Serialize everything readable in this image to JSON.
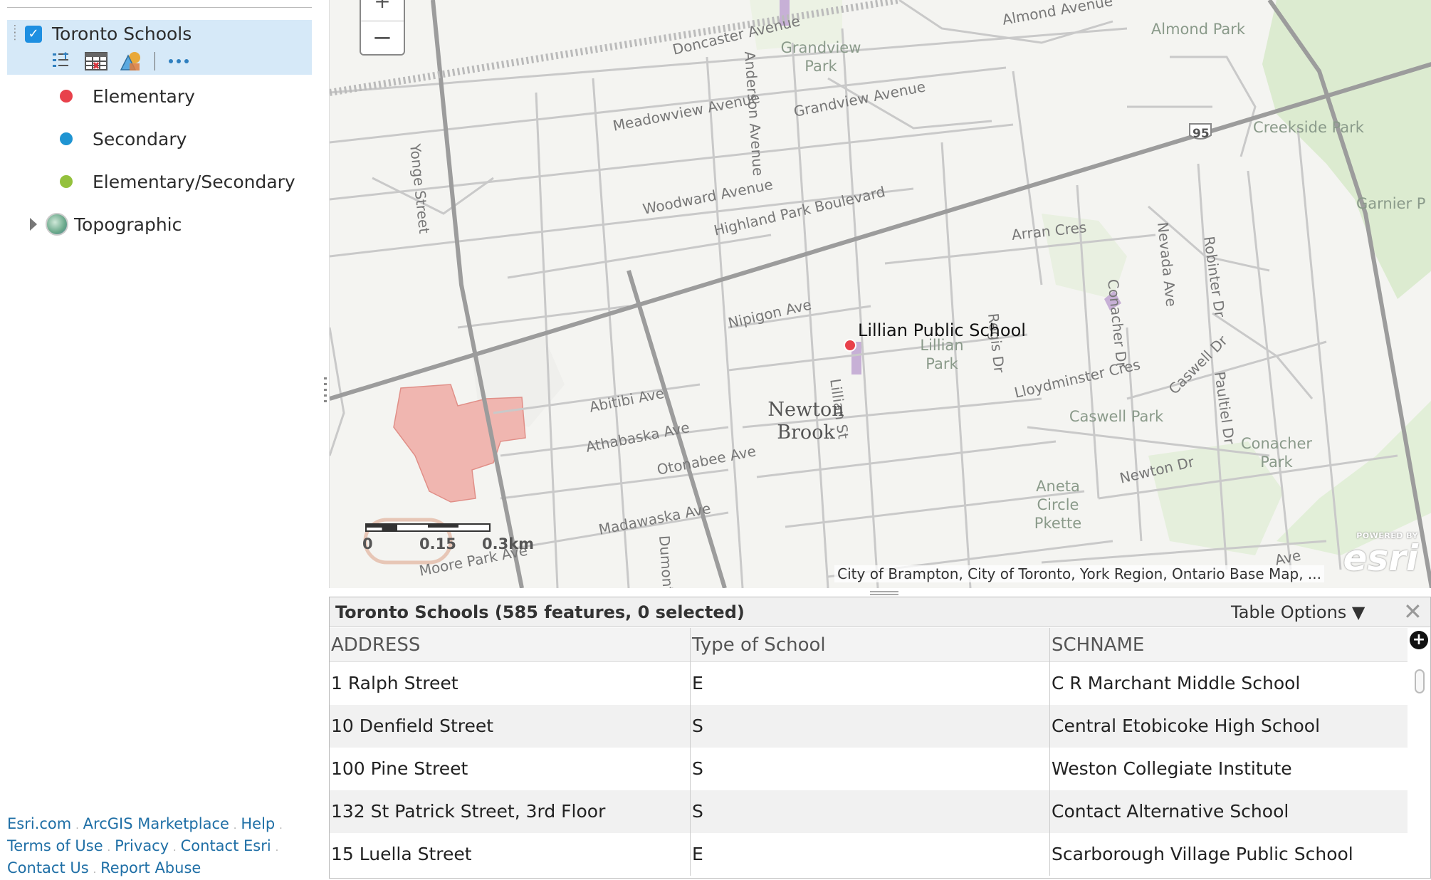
{
  "layer_list": {
    "layer_name": "Toronto Schools",
    "checked": true,
    "tools": [
      "legend-icon",
      "table-icon",
      "styles-icon",
      "more-icon"
    ],
    "legend": [
      {
        "label": "Elementary",
        "color": "#e8414b"
      },
      {
        "label": "Secondary",
        "color": "#1f94d2"
      },
      {
        "label": "Elementary/Secondary",
        "color": "#94c13d"
      }
    ],
    "basemap": {
      "label": "Topographic"
    }
  },
  "footer": {
    "links": [
      "Esri.com",
      "ArcGIS Marketplace",
      "Help",
      "Terms of Use",
      "Privacy",
      "Contact Esri",
      "Contact Us",
      "Report Abuse"
    ]
  },
  "map": {
    "zoom_in_symbol": "+",
    "zoom_out_symbol": "−",
    "feature_label": "Lillian Public School",
    "streets": [
      "Doncaster Avenue",
      "Almond Avenue",
      "Meadowview Avenue",
      "Grandview Avenue",
      "Woodward Avenue",
      "Highland Park Boulevard",
      "Yonge Street",
      "Anderson Avenue",
      "Nipigon Ave",
      "Abitibi Ave",
      "Athabaska Ave",
      "Otonabee Ave",
      "Madawaska Ave",
      "Moore Park Ave",
      "Dumont St",
      "Lillian St",
      "Arran Cres",
      "Regis Dr",
      "Lloydminster Cres",
      "Caswell Dr",
      "Conacher Dr",
      "Nevada Ave",
      "Robinter Dr",
      "Paultiel Dr",
      "Newton Dr",
      "Ave"
    ],
    "highway_shield": "95",
    "parks": [
      "Grandview\nPark",
      "Almond Park",
      "Creekside Park",
      "Garnier P",
      "Lillian\nPark",
      "Caswell Park",
      "Conacher\nPark",
      "Aneta\nCircle Pkette"
    ],
    "neighbourhood": "Newton\nBrook",
    "scalebar": {
      "zero": "0",
      "mid": "0.15",
      "end": "0.3km"
    },
    "attribution": "City of Brampton, City of Toronto, York Region, Ontario Base Map, ...",
    "esri": {
      "powered_by": "POWERED BY",
      "brand": "esri"
    }
  },
  "table": {
    "title": "Toronto Schools (585 features, 0 selected)",
    "options_label": "Table Options ▼",
    "close_symbol": "✕",
    "add_symbol": "+",
    "columns": [
      "ADDRESS",
      "Type of School",
      "SCHNAME"
    ],
    "rows": [
      [
        "1 Ralph Street",
        "E",
        "C R Marchant Middle School"
      ],
      [
        "10 Denfield Street",
        "S",
        "Central Etobicoke High School"
      ],
      [
        "100 Pine Street",
        "S",
        "Weston Collegiate Institute"
      ],
      [
        "132 St Patrick Street, 3rd Floor",
        "S",
        "Contact Alternative School"
      ],
      [
        "15 Luella Street",
        "E",
        "Scarborough Village Public School"
      ]
    ]
  }
}
